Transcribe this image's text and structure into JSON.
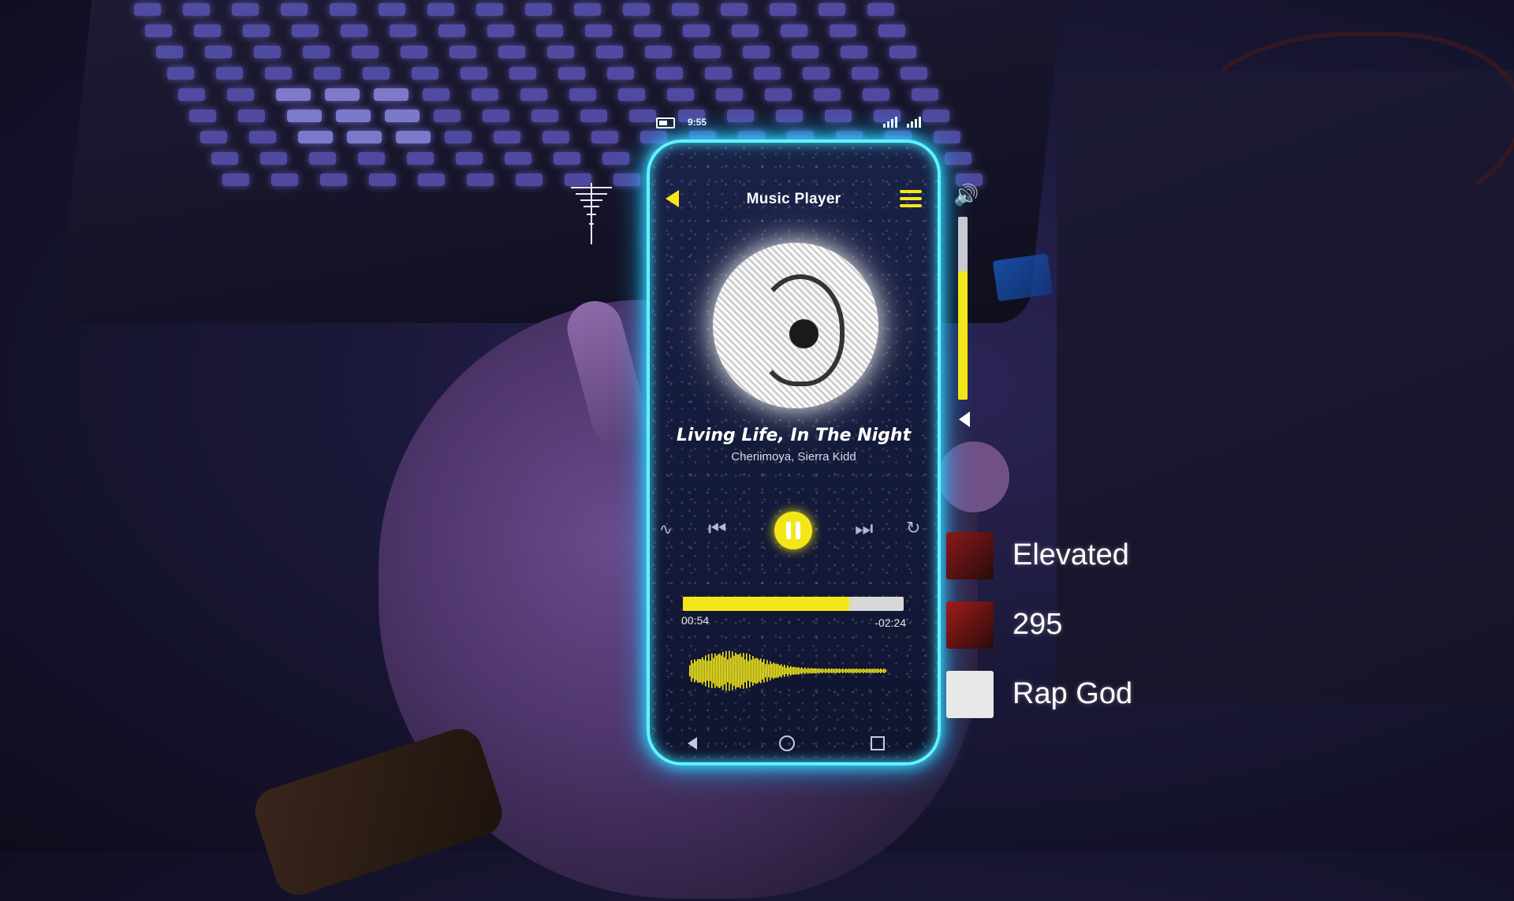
{
  "colors": {
    "accent": "#f3e71a",
    "neon": "#5ff4ff",
    "background": "#1a1838"
  },
  "status_bar": {
    "time": "9:55",
    "battery_icon": "battery-icon",
    "signal_icon": "signal-icon"
  },
  "player": {
    "title": "Music Player",
    "back_icon": "back-arrow-icon",
    "menu_icon": "hamburger-menu-icon",
    "song": {
      "title": "Living Life, In The Night",
      "artist": "Cheriimoya, Sierra Kidd"
    },
    "controls": {
      "shuffle_icon": "shuffle-icon",
      "previous_icon": "skip-previous-icon",
      "play_state": "playing",
      "pause_icon": "pause-icon",
      "next_icon": "skip-next-icon",
      "repeat_icon": "repeat-icon"
    },
    "progress": {
      "elapsed": "00:54",
      "remaining": "-02:24",
      "fraction": 0.75
    },
    "nav": [
      "nav-back-icon",
      "nav-home-icon",
      "nav-recents-icon"
    ]
  },
  "volume": {
    "icon": "volume-high-icon",
    "low_icon": "volume-low-icon",
    "level": 0.7
  },
  "playlist": [
    {
      "label": "Elevated",
      "thumb_color": "#8a1a1a"
    },
    {
      "label": "295",
      "thumb_color": "#a11c1c"
    },
    {
      "label": "Rap God",
      "thumb_color": "#e8e8e8"
    }
  ]
}
